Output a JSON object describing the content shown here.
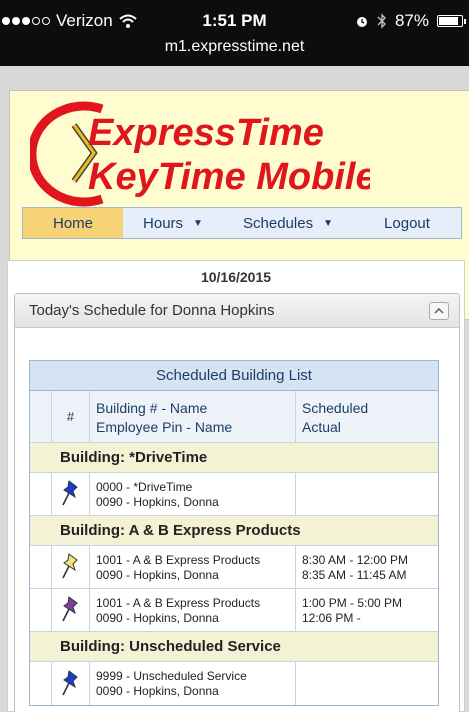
{
  "status_bar": {
    "carrier": "Verizon",
    "time": "1:51 PM",
    "battery": "87%",
    "battery_level": 0.87,
    "url": "m1.expresstime.net"
  },
  "app": {
    "logo_line1": "ExpressTime",
    "logo_line2": "KeyTime Mobile"
  },
  "nav": {
    "home": "Home",
    "hours": "Hours",
    "schedules": "Schedules",
    "logout": "Logout"
  },
  "date": "10/16/2015",
  "panel": {
    "title": "Today's Schedule for Donna Hopkins"
  },
  "table": {
    "caption": "Scheduled Building List",
    "col_num": "#",
    "col_building_line1": "Building # - Name",
    "col_building_line2": "Employee Pin - Name",
    "col_sched_line1": "Scheduled",
    "col_sched_line2": "Actual",
    "groups": [
      {
        "label": "Building: *DriveTime",
        "rows": [
          {
            "pin_color": "#1a3ccf",
            "building": "0000 - *DriveTime",
            "employee": "0090 - Hopkins, Donna",
            "scheduled": "",
            "actual": ""
          }
        ]
      },
      {
        "label": "Building: A & B Express Products",
        "rows": [
          {
            "pin_color": "#f2e27a",
            "building": "1001 - A & B Express Products",
            "employee": "0090 - Hopkins, Donna",
            "scheduled": "8:30 AM - 12:00 PM",
            "actual": "8:35 AM - 11:45 AM"
          },
          {
            "pin_color": "#7a3fa0",
            "building": "1001 - A & B Express Products",
            "employee": "0090 - Hopkins, Donna",
            "scheduled": "1:00 PM - 5:00 PM",
            "actual": "12:06 PM -"
          }
        ]
      },
      {
        "label": "Building: Unscheduled Service",
        "rows": [
          {
            "pin_color": "#1a3ccf",
            "building": "9999 - Unscheduled Service",
            "employee": "0090 - Hopkins, Donna",
            "scheduled": "",
            "actual": ""
          }
        ]
      }
    ]
  }
}
